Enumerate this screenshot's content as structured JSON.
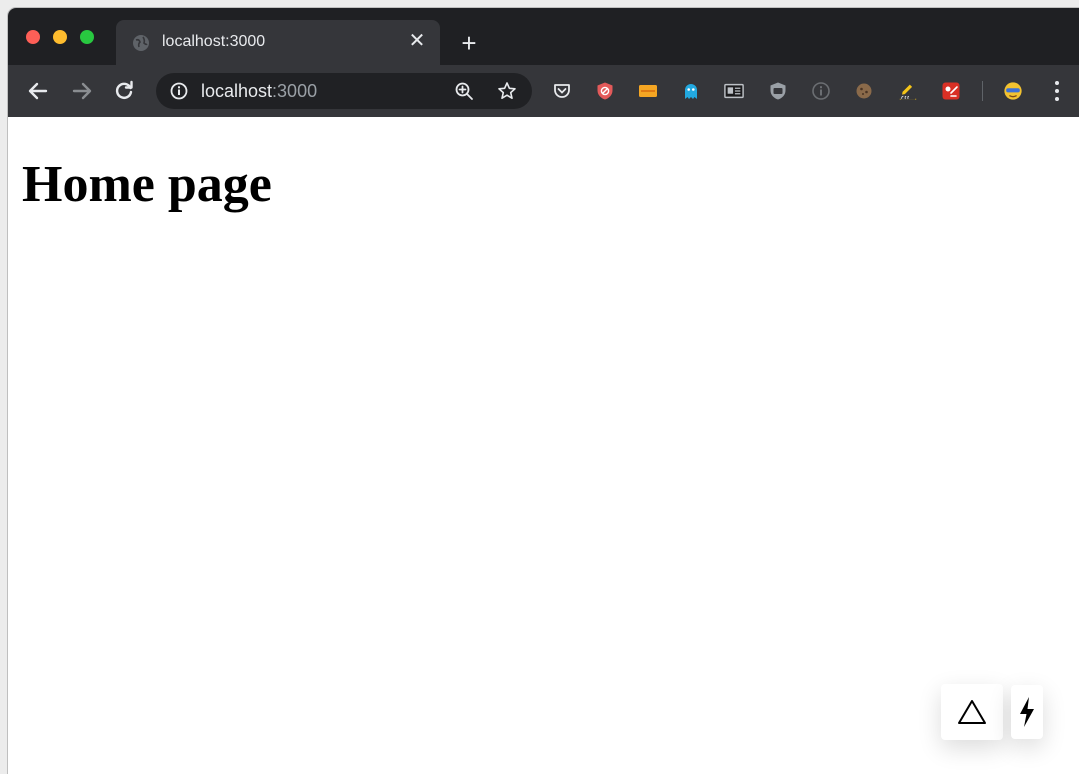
{
  "window_controls": {
    "close_color": "#fe5f57",
    "minimize_color": "#febc2e",
    "maximize_color": "#28c840"
  },
  "tab": {
    "title": "localhost:3000",
    "favicon_icon": "globe-icon",
    "close_icon": "close-icon",
    "close_glyph": "✕"
  },
  "new_tab": {
    "icon": "plus-icon",
    "glyph": "+"
  },
  "toolbar": {
    "back_icon": "arrow-left-icon",
    "forward_icon": "arrow-right-icon",
    "reload_icon": "reload-icon"
  },
  "omnibox": {
    "host": "localhost",
    "port": ":3000",
    "info_icon": "info-icon",
    "zoom_icon": "zoom-icon",
    "bookmark_icon": "star-icon"
  },
  "extensions": [
    "pocket-icon",
    "shield-block-icon",
    "honey-icon",
    "ghostery-icon",
    "reader-icon",
    "ublock-icon",
    "info-circle-icon",
    "cookie-icon",
    "css-pencil-icon",
    "recorder-icon",
    "avatar-icon"
  ],
  "menu_icon": "kebab-menu-icon",
  "page": {
    "heading": "Home page"
  },
  "indicators": {
    "build_icon": "triangle-icon",
    "prerender_icon": "lightning-icon"
  },
  "colors": {
    "tabbar": "#1f2023",
    "toolbar": "#35363a",
    "omnibox": "#202124",
    "text_light": "#e8eaed",
    "text_dim": "#9aa0a6"
  }
}
